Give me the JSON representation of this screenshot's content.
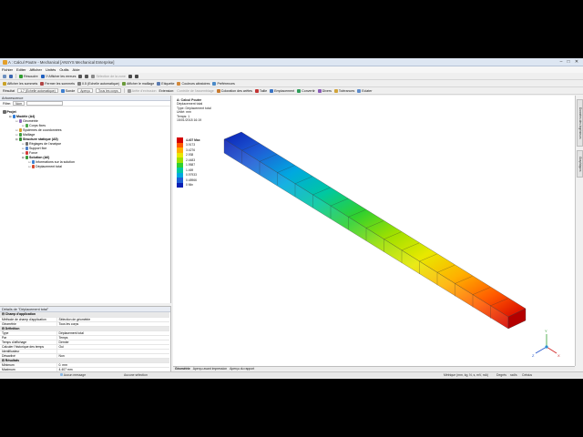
{
  "window": {
    "title": "A : Calcul Poutre - Mechanical [ANSYS Mechanical Enterprise]"
  },
  "menu": [
    "Fichier",
    "Editer",
    "Afficher",
    "Unités",
    "Outils",
    "Aide"
  ],
  "toolbar1": [
    {
      "label": "Résoudre",
      "icon": "solve-icon",
      "color": "#2f9e2f",
      "disabled": false
    },
    {
      "label": "?/ Afficher les erreurs",
      "icon": "error-icon",
      "color": "#1f5fbf",
      "disabled": false
    },
    {
      "label": "",
      "icon": "pointer-icon",
      "color": "#555555",
      "disabled": false
    },
    {
      "label": "",
      "icon": "zoom-icon",
      "color": "#555555",
      "disabled": false
    },
    {
      "label": "Sélection de la zone",
      "icon": "box-select-icon",
      "color": "#8a8a8a",
      "disabled": true
    },
    {
      "label": "",
      "icon": "rotate-icon",
      "color": "#4a4a4a",
      "disabled": false
    },
    {
      "label": "",
      "icon": "pan-icon",
      "color": "#4a4a4a",
      "disabled": false
    }
  ],
  "toolbar2": [
    {
      "label": "Afficher les sommets",
      "icon": "vertex-icon"
    },
    {
      "label": "Fermer les sommets",
      "icon": "close-vertex-icon"
    },
    {
      "label": "0.5 (Echelle automatique)",
      "icon": "scale-icon"
    },
    {
      "label": "Afficher le maillage",
      "icon": "mesh-icon"
    },
    {
      "label": "Etiquette",
      "icon": "label-icon"
    },
    {
      "label": "Couleurs aléatoires",
      "icon": "colors-icon"
    },
    {
      "label": "Préférences",
      "icon": "prefs-icon"
    }
  ],
  "toolbar3": [
    {
      "label": "Arête d'extrusion",
      "icon": "edge-icon",
      "disabled": true
    },
    {
      "label": "Extension:",
      "icon": "",
      "disabled": false
    },
    {
      "label": "Contrôle de l'assemblage",
      "icon": "",
      "disabled": true
    },
    {
      "label": "Coloration des arêtes",
      "icon": "edge-color-icon",
      "disabled": false
    },
    {
      "label": "Taille",
      "icon": "size-icon",
      "disabled": false
    },
    {
      "label": "Emplacement",
      "icon": "location-icon",
      "disabled": false
    },
    {
      "label": "Convertir",
      "icon": "convert-icon",
      "disabled": false
    },
    {
      "label": "Divers",
      "icon": "misc-icon",
      "disabled": false
    },
    {
      "label": "Tolérances",
      "icon": "tolerance-icon",
      "disabled": false
    }
  ],
  "toolbar4": {
    "result_label": "Résultat",
    "result_scale": "1.7 (Echelle automatique)",
    "probe_label": "Sonde",
    "body_label": "Tous les corps",
    "assembly_label": "Aperçu"
  },
  "toolbar5": {
    "explode_label": "Eclater"
  },
  "outline": {
    "header": "Arborescence",
    "filter_label": "Filtre:",
    "filter_value": "Nom",
    "nodes": [
      {
        "label": "Projet",
        "indent": 0,
        "bold": true,
        "icon": "project-icon",
        "color": "#6a6a6a"
      },
      {
        "label": "Modèle (A4)",
        "indent": 1,
        "bold": true,
        "icon": "model-icon",
        "color": "#2e7bd6"
      },
      {
        "label": "Géométrie",
        "indent": 2,
        "bold": false,
        "icon": "geometry-icon",
        "color": "#8e6bbf"
      },
      {
        "label": "Corps fixes",
        "indent": 3,
        "bold": false,
        "icon": "body-icon",
        "color": "#4aa84a"
      },
      {
        "label": "Systèmes de coordonnées",
        "indent": 2,
        "bold": false,
        "icon": "coordinate-icon",
        "color": "#d69b2e"
      },
      {
        "label": "Maillage",
        "indent": 2,
        "bold": false,
        "icon": "mesh-icon",
        "color": "#3f9e3f"
      },
      {
        "label": "Structure statique (A5)",
        "indent": 2,
        "bold": true,
        "icon": "static-icon",
        "color": "#2f8d2f"
      },
      {
        "label": "Réglages de l'analyse",
        "indent": 3,
        "bold": false,
        "icon": "settings-icon",
        "color": "#6e6e6e"
      },
      {
        "label": "Support fixe",
        "indent": 3,
        "bold": false,
        "icon": "support-icon",
        "color": "#4d7fc9"
      },
      {
        "label": "Force",
        "indent": 3,
        "bold": false,
        "icon": "force-icon",
        "color": "#d23b3b"
      },
      {
        "label": "Solution (A6)",
        "indent": 3,
        "bold": true,
        "icon": "solution-icon",
        "color": "#3a9a3a"
      },
      {
        "label": "Informations sur la solution",
        "indent": 4,
        "bold": false,
        "icon": "info-icon",
        "color": "#3f83d1"
      },
      {
        "label": "Déplacement total",
        "indent": 4,
        "bold": false,
        "icon": "deformation-icon",
        "color": "#d64a2e"
      }
    ]
  },
  "details": {
    "header": "Détails de \"Déplacement total\"",
    "rows": [
      {
        "type": "section",
        "k": "Champ d'application",
        "v": ""
      },
      {
        "type": "row",
        "k": "Méthode de champ d'application",
        "v": "Sélection de géométrie"
      },
      {
        "type": "row",
        "k": "Géométrie",
        "v": "Tous les corps"
      },
      {
        "type": "section",
        "k": "Définition",
        "v": ""
      },
      {
        "type": "row",
        "k": "Type",
        "v": "Déplacement total"
      },
      {
        "type": "row",
        "k": "Par",
        "v": "Temps"
      },
      {
        "type": "row",
        "k": "Temps d'affichage",
        "v": "Dernier"
      },
      {
        "type": "row",
        "k": "Calculer l'historique des temps",
        "v": "Oui"
      },
      {
        "type": "row",
        "k": "Identificateur",
        "v": ""
      },
      {
        "type": "row",
        "k": "Désactivé",
        "v": "Non"
      },
      {
        "type": "section",
        "k": "Résultats",
        "v": ""
      },
      {
        "type": "row",
        "k": "Minimum",
        "v": "0. mm"
      },
      {
        "type": "row",
        "k": "Maximum",
        "v": "4.407 mm"
      },
      {
        "type": "row",
        "k": "Valeur minimale sur",
        "v": "Corps fixes"
      },
      {
        "type": "row",
        "k": "Valeur maximale sur",
        "v": "Corps fixes"
      },
      {
        "type": "section",
        "k": "Informations",
        "v": ""
      }
    ]
  },
  "viewport": {
    "info": [
      "A: Calcul Poutre",
      "Déplacement total",
      "Type: Déplacement total",
      "Unité: mm",
      "Temps: 1",
      "15/01/2018 16:19"
    ],
    "legend": [
      {
        "label": "4.407 Max",
        "color": "#d40000"
      },
      {
        "label": "3.9173",
        "color": "#ff5a00"
      },
      {
        "label": "3.4276",
        "color": "#ffb000"
      },
      {
        "label": "2.938",
        "color": "#e8e800"
      },
      {
        "label": "2.4483",
        "color": "#9ee000"
      },
      {
        "label": "1.9587",
        "color": "#2fd02f"
      },
      {
        "label": "1.469",
        "color": "#00c8a0"
      },
      {
        "label": "0.97933",
        "color": "#00a8e0"
      },
      {
        "label": "0.48966",
        "color": "#1f5fd6"
      },
      {
        "label": "0 Min",
        "color": "#0a1fb4"
      }
    ],
    "beam_gradient": [
      "#0a1fb4",
      "#1f5fd6",
      "#00a8e0",
      "#00c8a0",
      "#2fd02f",
      "#9ee000",
      "#e8e800",
      "#ffb000",
      "#ff5a00",
      "#d40000"
    ]
  },
  "bottom_tabs": [
    "Géométrie",
    "Aperçu avant impression",
    "Aperçu du rapport"
  ],
  "status": {
    "messages": "Aucun message",
    "selection": "Aucune sélection",
    "units": "Métrique (mm, kg, N, s, mV, mA)",
    "angle": "Degrés",
    "rad": "rad/s",
    "temp": "Celsius"
  },
  "right_rail": [
    "Données des Ingénieurs",
    "Graphiques"
  ]
}
